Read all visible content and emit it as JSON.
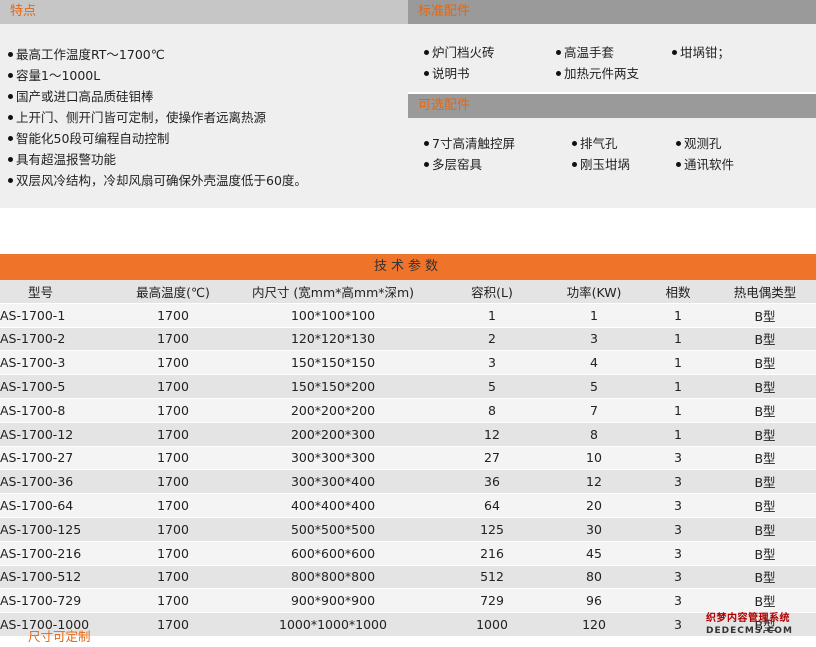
{
  "features": {
    "title": "特点",
    "items": [
      "最高工作温度RT～1700℃",
      "容量1～1000L",
      "国产或进口高品质硅钼棒",
      "上开门、侧开门皆可定制，使操作者远离热源",
      "智能化50段可编程自动控制",
      "具有超温报警功能",
      "双层风冷结构，冷却风扇可确保外壳温度低于60度。"
    ]
  },
  "standard_accessories": {
    "title": "标准配件",
    "items": [
      "炉门档火砖",
      "高温手套",
      "坩埚钳；",
      "说明书",
      "加热元件两支"
    ]
  },
  "optional_accessories": {
    "title": "可选配件",
    "items": [
      "7寸高清触控屏",
      "排气孔",
      "观测孔",
      "多层窑具",
      "刚玉坩埚",
      "通讯软件"
    ]
  },
  "specs": {
    "title": "技术参数",
    "headers": [
      "型号",
      "最高温度(℃)",
      "内尺寸 (宽mm*高mm*深m)",
      "容积(L)",
      "功率(KW)",
      "相数",
      "热电偶类型"
    ],
    "rows": [
      [
        "AS-1700-1",
        "1700",
        "100*100*100",
        "1",
        "1",
        "1",
        "B型"
      ],
      [
        "AS-1700-2",
        "1700",
        "120*120*130",
        "2",
        "3",
        "1",
        "B型"
      ],
      [
        "AS-1700-3",
        "1700",
        "150*150*150",
        "3",
        "4",
        "1",
        "B型"
      ],
      [
        "AS-1700-5",
        "1700",
        "150*150*200",
        "5",
        "5",
        "1",
        "B型"
      ],
      [
        "AS-1700-8",
        "1700",
        "200*200*200",
        "8",
        "7",
        "1",
        "B型"
      ],
      [
        "AS-1700-12",
        "1700",
        "200*200*300",
        "12",
        "8",
        "1",
        "B型"
      ],
      [
        "AS-1700-27",
        "1700",
        "300*300*300",
        "27",
        "10",
        "3",
        "B型"
      ],
      [
        "AS-1700-36",
        "1700",
        "300*300*400",
        "36",
        "12",
        "3",
        "B型"
      ],
      [
        "AS-1700-64",
        "1700",
        "400*400*400",
        "64",
        "20",
        "3",
        "B型"
      ],
      [
        "AS-1700-125",
        "1700",
        "500*500*500",
        "125",
        "30",
        "3",
        "B型"
      ],
      [
        "AS-1700-216",
        "1700",
        "600*600*600",
        "216",
        "45",
        "3",
        "B型"
      ],
      [
        "AS-1700-512",
        "1700",
        "800*800*800",
        "512",
        "80",
        "3",
        "B型"
      ],
      [
        "AS-1700-729",
        "1700",
        "900*900*900",
        "729",
        "96",
        "3",
        "B型"
      ],
      [
        "AS-1700-1000",
        "1700",
        "1000*1000*1000",
        "1000",
        "120",
        "3",
        "B型"
      ]
    ],
    "note": "尺寸可定制"
  },
  "watermark": {
    "line1": "织梦内容管理系统",
    "line2": "DEDECMS.COM"
  },
  "colors": {
    "accent": "#e8660f",
    "header_bar": "#f0732a"
  }
}
